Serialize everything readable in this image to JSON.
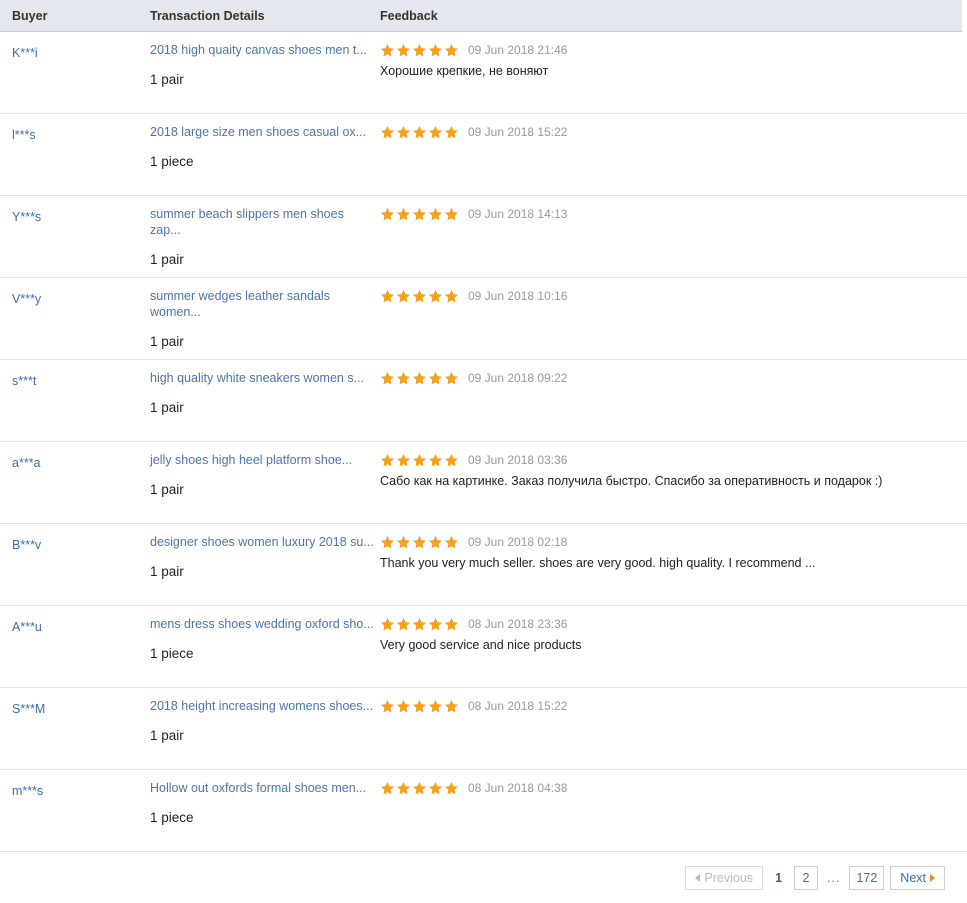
{
  "table": {
    "columns": {
      "buyer": "Buyer",
      "transaction_details": "Transaction Details",
      "feedback": "Feedback"
    },
    "rows": [
      {
        "buyer": "K***i",
        "product": "2018 high quaity canvas shoes men t...",
        "quantity": "1 pair",
        "rating": 5,
        "date": "09 Jun 2018 21:46",
        "comment": "Хорошие крепкие, не воняют"
      },
      {
        "buyer": "l***s",
        "product": "2018 large size men shoes casual ox...",
        "quantity": "1 piece",
        "rating": 5,
        "date": "09 Jun 2018 15:22",
        "comment": ""
      },
      {
        "buyer": "Y***s",
        "product": "summer beach slippers men shoes zap...",
        "quantity": "1 pair",
        "rating": 5,
        "date": "09 Jun 2018 14:13",
        "comment": ""
      },
      {
        "buyer": "V***y",
        "product": "summer wedges leather sandals women...",
        "quantity": "1 pair",
        "rating": 5,
        "date": "09 Jun 2018 10:16",
        "comment": ""
      },
      {
        "buyer": "s***t",
        "product": "high quality white sneakers women s...",
        "quantity": "1 pair",
        "rating": 5,
        "date": "09 Jun 2018 09:22",
        "comment": ""
      },
      {
        "buyer": "a***a",
        "product": "jelly shoes high heel platform shoe...",
        "quantity": "1 pair",
        "rating": 5,
        "date": "09 Jun 2018 03:36",
        "comment": "Сабо как на картинке. Заказ получила быстро. Спасибо за оперативность и подарок :)"
      },
      {
        "buyer": "B***v",
        "product": "designer shoes women luxury 2018 su...",
        "quantity": "1 pair",
        "rating": 5,
        "date": "09 Jun 2018 02:18",
        "comment": "Thank you very much seller. shoes are very good. high quality. I recommend ..."
      },
      {
        "buyer": "A***u",
        "product": "mens dress shoes wedding oxford sho...",
        "quantity": "1 piece",
        "rating": 5,
        "date": "08 Jun 2018 23:36",
        "comment": "Very good service and nice products"
      },
      {
        "buyer": "S***M",
        "product": "2018 height increasing womens shoes...",
        "quantity": "1 pair",
        "rating": 5,
        "date": "08 Jun 2018 15:22",
        "comment": ""
      },
      {
        "buyer": "m***s",
        "product": "Hollow out oxfords formal shoes men...",
        "quantity": "1 piece",
        "rating": 5,
        "date": "08 Jun 2018 04:38",
        "comment": ""
      }
    ]
  },
  "pagination": {
    "previous_label": "Previous",
    "next_label": "Next",
    "ellipsis": "...",
    "pages": [
      "1",
      "2",
      "172"
    ],
    "current_page": "1"
  },
  "colors": {
    "header_bg": "#e4e7ee",
    "link": "#4a76ab",
    "star": "#f5a11e",
    "accent": "#f08c1e"
  }
}
